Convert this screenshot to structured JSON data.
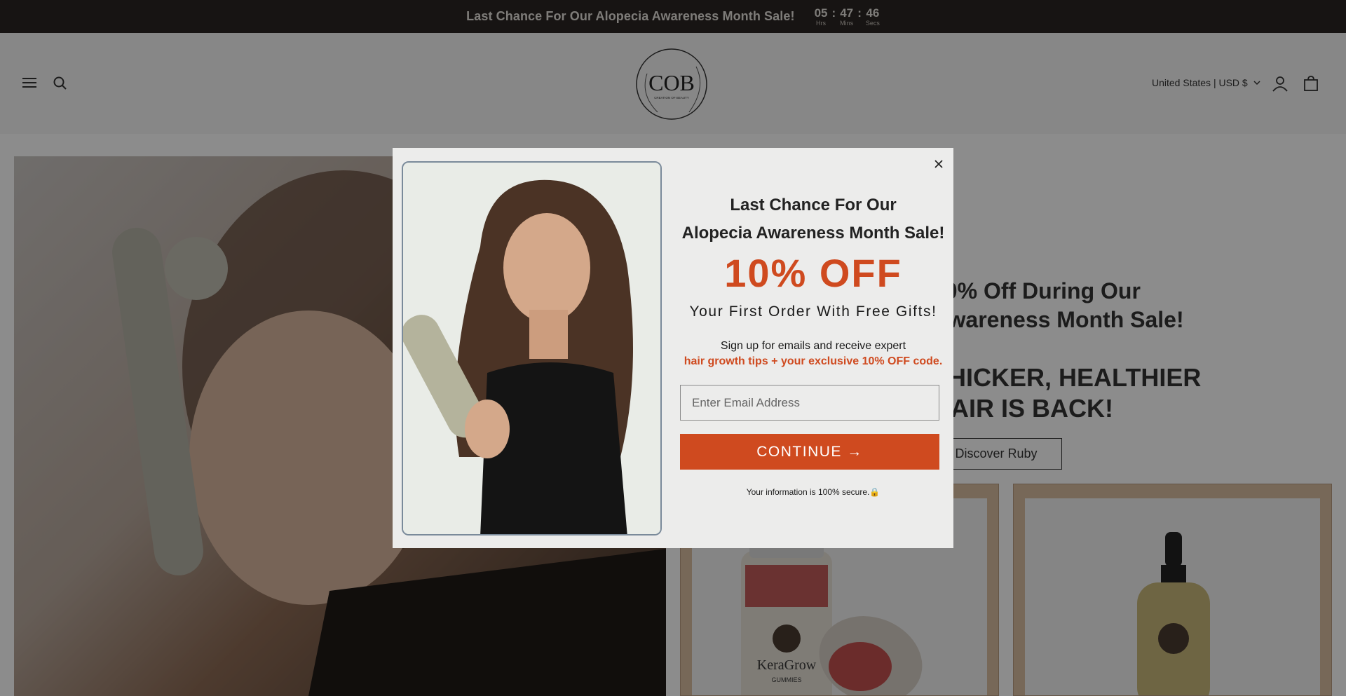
{
  "announcement": {
    "text": "Last Chance For Our Alopecia Awareness Month Sale!",
    "timer": {
      "hours": "05",
      "hours_label": "Hrs",
      "mins": "47",
      "mins_label": "Mins",
      "secs": "46",
      "secs_label": "Secs",
      "separator": ":"
    }
  },
  "header": {
    "logo_text": "COB",
    "logo_subtext": "CREATION OF BEAUTY",
    "country_selector": "United States | USD $",
    "icons": [
      "menu-icon",
      "search-icon",
      "account-icon",
      "cart-icon"
    ]
  },
  "hero": {
    "heading_line1": "10% Off During Our",
    "heading_line2": "Awareness Month Sale!",
    "tagline_line1": "THICKER, HEALTHIER",
    "tagline_line2": "HAIR IS BACK!",
    "discover_button": "Discover Ruby",
    "product1_brand": "KeraGrow",
    "product1_sub": "GUMMIES"
  },
  "modal": {
    "title_line1": "Last Chance For Our",
    "title_line2": "Alopecia Awareness Month Sale!",
    "offer": "10% OFF",
    "subtitle": "Your First Order With Free Gifts!",
    "description_line1": "Sign up for emails and receive expert",
    "description_line2": "hair growth tips + your exclusive 10% OFF code.",
    "email_placeholder": "Enter Email Address",
    "continue_label": "CONTINUE →",
    "secure_text": "Your information is 100% secure.🔒",
    "close_label": "×"
  },
  "colors": {
    "accent": "#cf4a1f",
    "announcement_bg": "#2b2623",
    "product_card": "#d9bda0"
  }
}
